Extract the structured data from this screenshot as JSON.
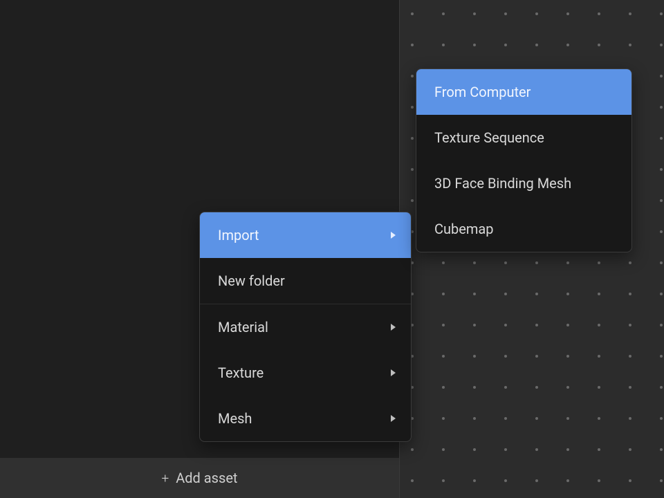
{
  "bottom_bar": {
    "label": "Add asset"
  },
  "primary_menu": {
    "items": [
      {
        "label": "Import",
        "has_submenu": true,
        "selected": true
      },
      {
        "label": "New folder",
        "has_submenu": false,
        "selected": false
      },
      {
        "label": "Material",
        "has_submenu": true,
        "selected": false
      },
      {
        "label": "Texture",
        "has_submenu": true,
        "selected": false
      },
      {
        "label": "Mesh",
        "has_submenu": true,
        "selected": false
      }
    ]
  },
  "sub_menu": {
    "items": [
      {
        "label": "From Computer",
        "selected": true
      },
      {
        "label": "Texture Sequence",
        "selected": false
      },
      {
        "label": "3D Face Binding Mesh",
        "selected": false
      },
      {
        "label": "Cubemap",
        "selected": false
      }
    ]
  }
}
